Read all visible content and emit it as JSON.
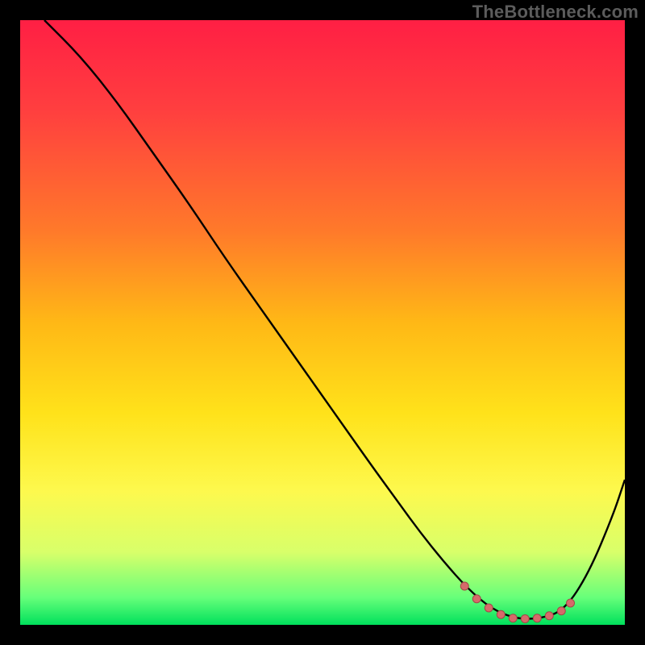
{
  "watermark": "TheBottleneck.com",
  "chart_data": {
    "type": "line",
    "title": "",
    "xlabel": "",
    "ylabel": "",
    "xlim": [
      0,
      100
    ],
    "ylim": [
      0,
      100
    ],
    "gradient_stops": [
      {
        "offset": 0.0,
        "color": "#ff1f44"
      },
      {
        "offset": 0.15,
        "color": "#ff3f3f"
      },
      {
        "offset": 0.35,
        "color": "#ff7a2a"
      },
      {
        "offset": 0.5,
        "color": "#ffb816"
      },
      {
        "offset": 0.65,
        "color": "#ffe21a"
      },
      {
        "offset": 0.78,
        "color": "#fdf94e"
      },
      {
        "offset": 0.88,
        "color": "#d8ff6a"
      },
      {
        "offset": 0.955,
        "color": "#66ff7a"
      },
      {
        "offset": 1.0,
        "color": "#00e05c"
      }
    ],
    "series": [
      {
        "name": "bottleneck-curve",
        "x": [
          4,
          10,
          16,
          22,
          28,
          34,
          40,
          46,
          52,
          58,
          62,
          66,
          70,
          74,
          78,
          82,
          86,
          90,
          94,
          98,
          100
        ],
        "y": [
          100,
          94,
          86.5,
          78,
          69.5,
          60.5,
          52,
          43.5,
          35,
          26.5,
          21,
          15.5,
          10.5,
          6,
          2.6,
          1.0,
          1.0,
          2.4,
          8.5,
          18,
          24
        ]
      }
    ],
    "markers": {
      "name": "optimal-range",
      "color": "#d66a6a",
      "radius": 5,
      "stroke": "#a24848",
      "x": [
        73.5,
        75.5,
        77.5,
        79.5,
        81.5,
        83.5,
        85.5,
        87.5,
        89.5,
        91.0
      ],
      "y": [
        6.4,
        4.3,
        2.8,
        1.7,
        1.1,
        1.0,
        1.1,
        1.5,
        2.3,
        3.6
      ]
    }
  }
}
